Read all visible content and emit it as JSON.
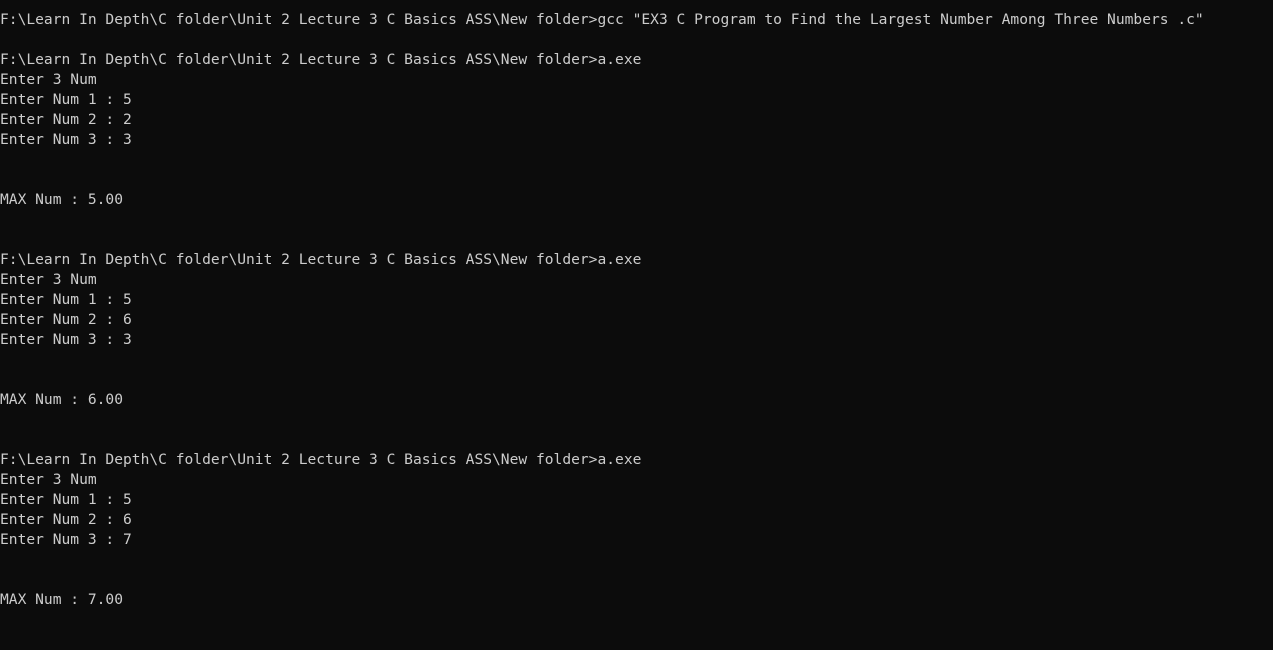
{
  "console": {
    "lines": [
      "F:\\Learn In Depth\\C folder\\Unit 2 Lecture 3 C Basics ASS\\New folder>gcc \"EX3 C Program to Find the Largest Number Among Three Numbers .c\"",
      "",
      "F:\\Learn In Depth\\C folder\\Unit 2 Lecture 3 C Basics ASS\\New folder>a.exe",
      "Enter 3 Num",
      "Enter Num 1 : 5",
      "Enter Num 2 : 2",
      "Enter Num 3 : 3",
      "",
      "",
      "MAX Num : 5.00",
      "",
      "",
      "F:\\Learn In Depth\\C folder\\Unit 2 Lecture 3 C Basics ASS\\New folder>a.exe",
      "Enter 3 Num",
      "Enter Num 1 : 5",
      "Enter Num 2 : 6",
      "Enter Num 3 : 3",
      "",
      "",
      "MAX Num : 6.00",
      "",
      "",
      "F:\\Learn In Depth\\C folder\\Unit 2 Lecture 3 C Basics ASS\\New folder>a.exe",
      "Enter 3 Num",
      "Enter Num 1 : 5",
      "Enter Num 2 : 6",
      "Enter Num 3 : 7",
      "",
      "",
      "MAX Num : 7.00"
    ]
  },
  "colors": {
    "background": "#0c0c0c",
    "foreground": "#cccccc"
  }
}
